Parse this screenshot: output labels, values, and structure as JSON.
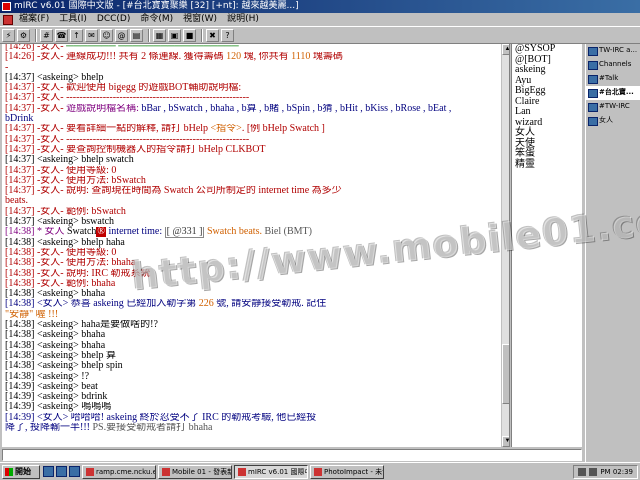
{
  "window": {
    "title": "mIRC v6.01 國際中文版 - [#台北寶寶聚樂 [32] [+nt]: 越來越美麗...]"
  },
  "menu": [
    "檔案(F)",
    "工具(I)",
    "DCC(D)",
    "命令(M)",
    "視窗(W)",
    "說明(H)"
  ],
  "toolbar_icons": [
    "connect-icon",
    "options-icon",
    "channels-icon",
    "address-book-icon",
    "dcc-send-icon",
    "dcc-chat-icon",
    "notify-icon",
    "urls-icon",
    "log-icon",
    "tile-icon",
    "cascade-icon",
    "colors-icon",
    "stop-icon",
    "help-icon"
  ],
  "chat": {
    "lines": [
      {
        "parts": [
          {
            "t": "[14:26] -女人- ",
            "c": "c-red"
          },
          {
            "t": "───────  ─────────────────",
            "c": "c-green"
          }
        ]
      },
      {
        "parts": [
          {
            "t": "[14:26] -女人- 連線成功!!! 共有 2 條連線. 獲得籌碼 ",
            "c": "c-red"
          },
          {
            "t": "120",
            "c": "c-orange"
          },
          {
            "t": " 塊, 你共有 ",
            "c": "c-red"
          },
          {
            "t": "1110",
            "c": "c-orange"
          },
          {
            "t": " 塊籌碼",
            "c": "c-red"
          }
        ]
      },
      {
        "parts": [
          {
            "t": "-",
            "c": "c-red"
          }
        ]
      },
      {
        "parts": [
          {
            "t": "[14:37] <askeing> bhelp",
            "c": ""
          }
        ]
      },
      {
        "parts": [
          {
            "t": "[14:37] -女人- 歡迎使用 bigegg 的遊戲BOT輔助說明檔:",
            "c": "c-red"
          }
        ]
      },
      {
        "parts": [
          {
            "t": "[14:37] -女人- -------------------------------------------------------",
            "c": "c-red"
          }
        ]
      },
      {
        "parts": [
          {
            "t": "[14:37] -女人- ",
            "c": "c-red"
          },
          {
            "t": "遊戲說明檔名稱:",
            "c": "c-purple"
          },
          {
            "t": " bBar , bSwatch , bhaha , b算 , b賭 , bSpin , b猜 , bHit , bKiss , bRose , bEat ,",
            "c": "c-blue"
          }
        ]
      },
      {
        "parts": [
          {
            "t": "  bDrink",
            "c": "c-blue"
          }
        ]
      },
      {
        "parts": [
          {
            "t": "[14:37] -女人- 要看詳細一點的解釋, 請打 bHelp ",
            "c": "c-red"
          },
          {
            "t": "<指令>",
            "c": "c-orange"
          },
          {
            "t": ". [例 bHelp Swatch ]",
            "c": "c-red"
          }
        ]
      },
      {
        "parts": [
          {
            "t": "[14:37] -女人- -------------------------------------------------------",
            "c": "c-red"
          }
        ]
      },
      {
        "parts": [
          {
            "t": "[14:37] -女人- 要查詢控制機器人的指令請打 bHelp CLKBOT",
            "c": "c-red"
          }
        ]
      },
      {
        "parts": [
          {
            "t": "[14:37] <askeing> bhelp swatch",
            "c": ""
          }
        ]
      },
      {
        "parts": [
          {
            "t": "[14:37] -女人- 使用等級: 0",
            "c": "c-red"
          }
        ]
      },
      {
        "parts": [
          {
            "t": "[14:37] -女人- 使用方法: bSwatch",
            "c": "c-red"
          }
        ]
      },
      {
        "parts": [
          {
            "t": "[14:37] -女人- 說明: 查詢現在時間為 Swatch 公司所制定的 internet time 為多少",
            "c": "c-red"
          }
        ]
      },
      {
        "parts": [
          {
            "t": "  beats.",
            "c": "c-red"
          }
        ]
      },
      {
        "parts": [
          {
            "t": "[14:37] -女人- 範例: bSwatch",
            "c": "c-red"
          }
        ]
      },
      {
        "parts": [
          {
            "t": "[14:37] <askeing> bswatch",
            "c": ""
          }
        ]
      },
      {
        "parts": [
          {
            "t": "[14:38] * 女人 ",
            "c": "c-purple"
          },
          {
            "t": "Swatch",
            "c": ""
          },
          {
            "t": "®",
            "c": "cursor-box"
          },
          {
            "t": " internet time: ",
            "c": "c-blue"
          },
          {
            "t": "[ @331 ]",
            "c": "hl-box"
          },
          {
            "t": " Swatch beats. ",
            "c": "c-orange"
          },
          {
            "t": "Biel (BMT)",
            "c": "c-gray"
          }
        ]
      },
      {
        "parts": [
          {
            "t": "[14:38] <askeing> bhelp haha",
            "c": ""
          }
        ]
      },
      {
        "parts": [
          {
            "t": "[14:38] -女人- 使用等級: 0",
            "c": "c-red"
          }
        ]
      },
      {
        "parts": [
          {
            "t": "[14:38] -女人- 使用方法: bhaha",
            "c": "c-red"
          }
        ]
      },
      {
        "parts": [
          {
            "t": "[14:38] -女人- 說明: IRC 勒戒系統",
            "c": "c-red"
          }
        ]
      },
      {
        "parts": [
          {
            "t": "[14:38] -女人- 範例: bhaha",
            "c": "c-red"
          }
        ]
      },
      {
        "parts": [
          {
            "t": "[14:38] <askeing> bhaha",
            "c": ""
          }
        ]
      },
      {
        "parts": [
          {
            "t": "[14:38] <女人> 恭喜 askeing 已經加入勒字第 ",
            "c": "c-blue"
          },
          {
            "t": "226",
            "c": "c-orange"
          },
          {
            "t": " 號, 請安靜接受勒戒. 記住",
            "c": "c-blue"
          }
        ]
      },
      {
        "parts": [
          {
            "t": "  \"安靜\" 喔 !!!",
            "c": "c-orange"
          }
        ]
      },
      {
        "parts": [
          {
            "t": "[14:38] <askeing> haha是要做啥的!?",
            "c": ""
          }
        ]
      },
      {
        "parts": [
          {
            "t": "[14:38] <askeing> bhaha",
            "c": ""
          }
        ]
      },
      {
        "parts": [
          {
            "t": "[14:38] <askeing> bhaha",
            "c": ""
          }
        ]
      },
      {
        "parts": [
          {
            "t": "[14:38] <askeing> bhelp 算",
            "c": ""
          }
        ]
      },
      {
        "parts": [
          {
            "t": "[14:38] <askeing> bhelp spin",
            "c": ""
          }
        ]
      },
      {
        "parts": [
          {
            "t": "[14:38] <askeing> !?",
            "c": ""
          }
        ]
      },
      {
        "parts": [
          {
            "t": "[14:39] <askeing> beat",
            "c": ""
          }
        ]
      },
      {
        "parts": [
          {
            "t": "[14:39] <askeing> bdrink",
            "c": ""
          }
        ]
      },
      {
        "parts": [
          {
            "t": "[14:39] <askeing> 嗚嗚嗚",
            "c": ""
          }
        ]
      },
      {
        "parts": [
          {
            "t": "[14:39] <女人> 哈哈哈! askeing 終於忍受不了 IRC 的勒戒考驗, 他已經投",
            "c": "c-blue"
          }
        ]
      },
      {
        "parts": [
          {
            "t": "  降了, 投降輸一半!!! ",
            "c": "c-blue"
          },
          {
            "t": "PS.要接受勒戒者請打 bhaha",
            "c": "c-gray"
          }
        ]
      }
    ]
  },
  "nicklist": [
    "@SYSOP",
    "@[BOT]",
    "askeing",
    "Ayu",
    "BigEgg",
    "Claire",
    "Lan",
    "wizard",
    "女人",
    "天使",
    "笨蛋",
    "精靈"
  ],
  "switchbar": [
    {
      "label": "TW-IRC a...",
      "active": false
    },
    {
      "label": "Channels",
      "active": false
    },
    {
      "label": "#Talk",
      "active": false
    },
    {
      "label": "#台北寶...",
      "active": true
    },
    {
      "label": "#TW-IRC",
      "active": false
    },
    {
      "label": "女人",
      "active": false
    }
  ],
  "watermark": "http://www.mobile01.com/",
  "taskbar": {
    "start_label": "開始",
    "tasks": [
      {
        "label": "ramp.cme.ncku.edu.tw...",
        "active": false
      },
      {
        "label": "Mobile 01 - 發表新...",
        "active": false
      },
      {
        "label": "mIRC v6.01 國際中...",
        "active": true
      },
      {
        "label": "PhotoImpact - 未命...",
        "active": false
      }
    ],
    "clock": "PM 02:39"
  }
}
